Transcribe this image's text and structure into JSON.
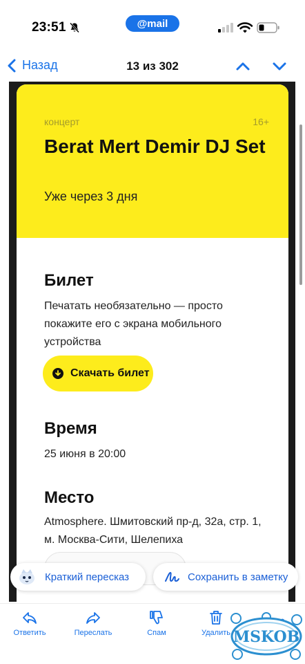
{
  "status_bar": {
    "time": "23:51",
    "app_badge": "@mail"
  },
  "nav": {
    "back_label": "Назад",
    "counter": "13 из 302"
  },
  "email": {
    "category": "концерт",
    "age_rating": "16+",
    "title": "Berat Mert Demir DJ Set",
    "countdown": "Уже через 3 дня",
    "ticket": {
      "heading": "Билет",
      "text": "Печатать необязательно — просто покажите его с экрана мобильного устройства",
      "download_label": "Скачать билет"
    },
    "time_section": {
      "heading": "Время",
      "value": "25 июня в 20:00"
    },
    "place_section": {
      "heading": "Место",
      "value": "Atmosphere. Шмитовский пр-д, 32а, стр. 1, м. Москва-Сити, Шелепиха"
    }
  },
  "chips": {
    "summary": "Краткий пересказ",
    "save_note": "Сохранить в заметку"
  },
  "toolbar": {
    "reply": "Ответить",
    "forward": "Переслать",
    "spam": "Спам",
    "delete": "Удалить"
  },
  "watermark": {
    "text": "MSKOB"
  },
  "colors": {
    "accent": "#1a73e8",
    "brand_yellow": "#fdec1c",
    "frame_dark": "#1b1b1b"
  }
}
